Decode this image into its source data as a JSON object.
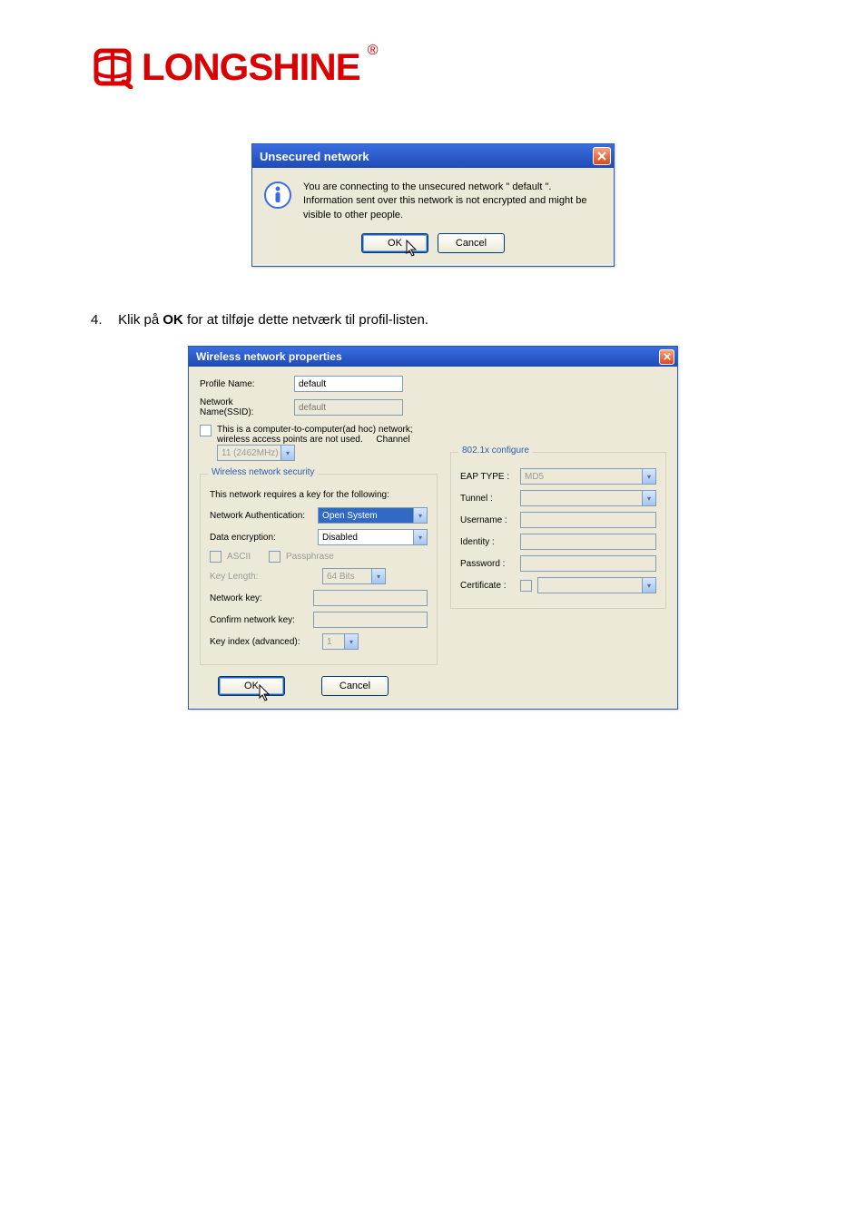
{
  "brand": {
    "name": "LONGSHINE",
    "reg": "®"
  },
  "dlg1": {
    "title": "Unsecured network",
    "message": "You are connecting to the unsecured network \" default \". Information sent over this network is not encrypted and might be visible to other people.",
    "ok": "OK",
    "cancel": "Cancel"
  },
  "instruction": {
    "num": "4.",
    "pre": "Klik på ",
    "bold": "OK",
    "post": " for at tilføje dette netværk til profil-listen."
  },
  "dlg2": {
    "title": "Wireless network properties",
    "profileNameLabel": "Profile Name:",
    "profileName": "default",
    "ssidLabel": "Network Name(SSID):",
    "ssid": "default",
    "adhocText": "This is a computer-to-computer(ad hoc) network; wireless access points are not used.",
    "channelLabel": "Channel",
    "channelValue": "11 (2462MHz)",
    "securityGroup": "Wireless network security",
    "requiresKey": "This network requires a key for the following:",
    "authLabel": "Network Authentication:",
    "authValue": "Open System",
    "encLabel": "Data encryption:",
    "encValue": "Disabled",
    "ascii": "ASCII",
    "passphrase": "Passphrase",
    "keyLenLabel": "Key Length:",
    "keyLenValue": "64 Bits",
    "netKeyLabel": "Network key:",
    "confirmKeyLabel": "Confirm network key:",
    "keyIndexLabel": "Key index (advanced):",
    "keyIndexValue": "1",
    "ok": "OK",
    "cancel": "Cancel",
    "configGroup": "802.1x configure",
    "eapLabel": "EAP TYPE :",
    "eapValue": "MD5",
    "tunnelLabel": "Tunnel :",
    "userLabel": "Username :",
    "identityLabel": "Identity :",
    "passLabel": "Password :",
    "certLabel": "Certificate :"
  }
}
